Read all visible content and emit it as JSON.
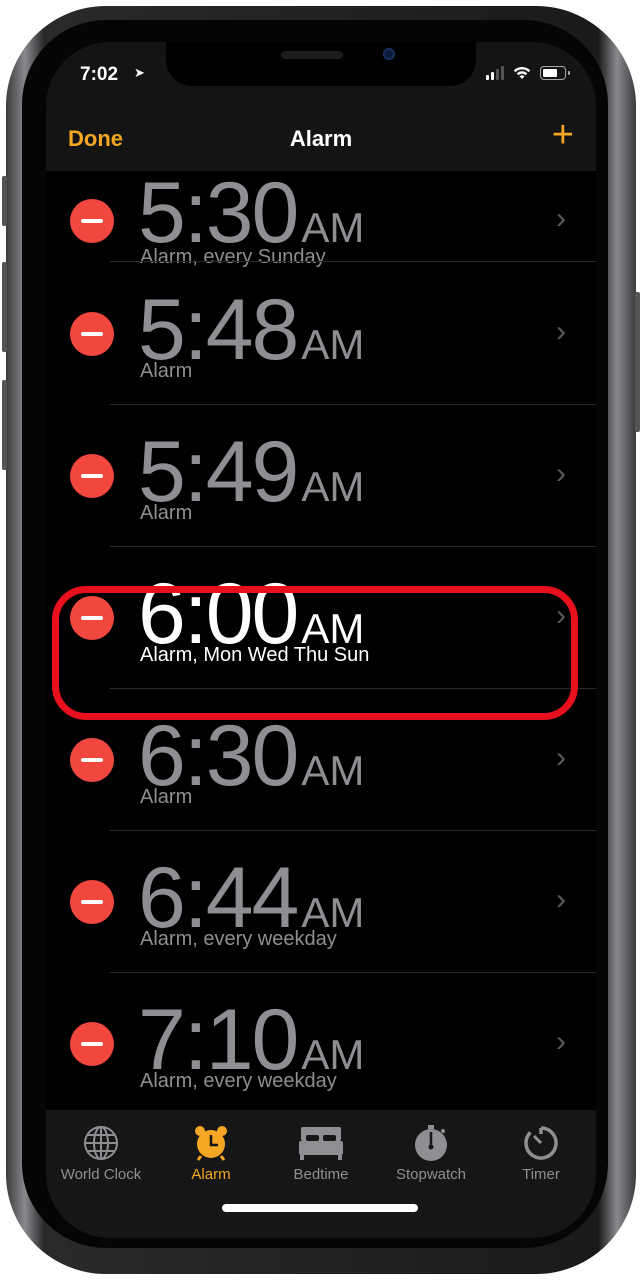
{
  "status_bar": {
    "time": "7:02",
    "location_icon": "location-arrow-icon",
    "signal_bars": 2,
    "wifi": true,
    "battery_level": 0.7
  },
  "nav": {
    "done_label": "Done",
    "title": "Alarm",
    "add_label": "+"
  },
  "colors": {
    "accent": "#f5a623",
    "delete_red": "#f2473f",
    "highlight_red": "#e8101c",
    "inactive_text": "#8e8e93"
  },
  "alarms": [
    {
      "time": "5:30",
      "ampm": "AM",
      "label": "Alarm, every Sunday",
      "active": false
    },
    {
      "time": "5:48",
      "ampm": "AM",
      "label": "Alarm",
      "active": false
    },
    {
      "time": "5:49",
      "ampm": "AM",
      "label": "Alarm",
      "active": false
    },
    {
      "time": "6:00",
      "ampm": "AM",
      "label": "Alarm, Mon Wed Thu Sun",
      "active": true
    },
    {
      "time": "6:30",
      "ampm": "AM",
      "label": "Alarm",
      "active": false
    },
    {
      "time": "6:44",
      "ampm": "AM",
      "label": "Alarm, every weekday",
      "active": false
    },
    {
      "time": "7:10",
      "ampm": "AM",
      "label": "Alarm, every weekday",
      "active": false
    }
  ],
  "tabs": [
    {
      "label": "World Clock",
      "icon": "globe-icon",
      "active": false
    },
    {
      "label": "Alarm",
      "icon": "alarm-clock-icon",
      "active": true
    },
    {
      "label": "Bedtime",
      "icon": "bed-icon",
      "active": false
    },
    {
      "label": "Stopwatch",
      "icon": "stopwatch-icon",
      "active": false
    },
    {
      "label": "Timer",
      "icon": "timer-icon",
      "active": false
    }
  ]
}
